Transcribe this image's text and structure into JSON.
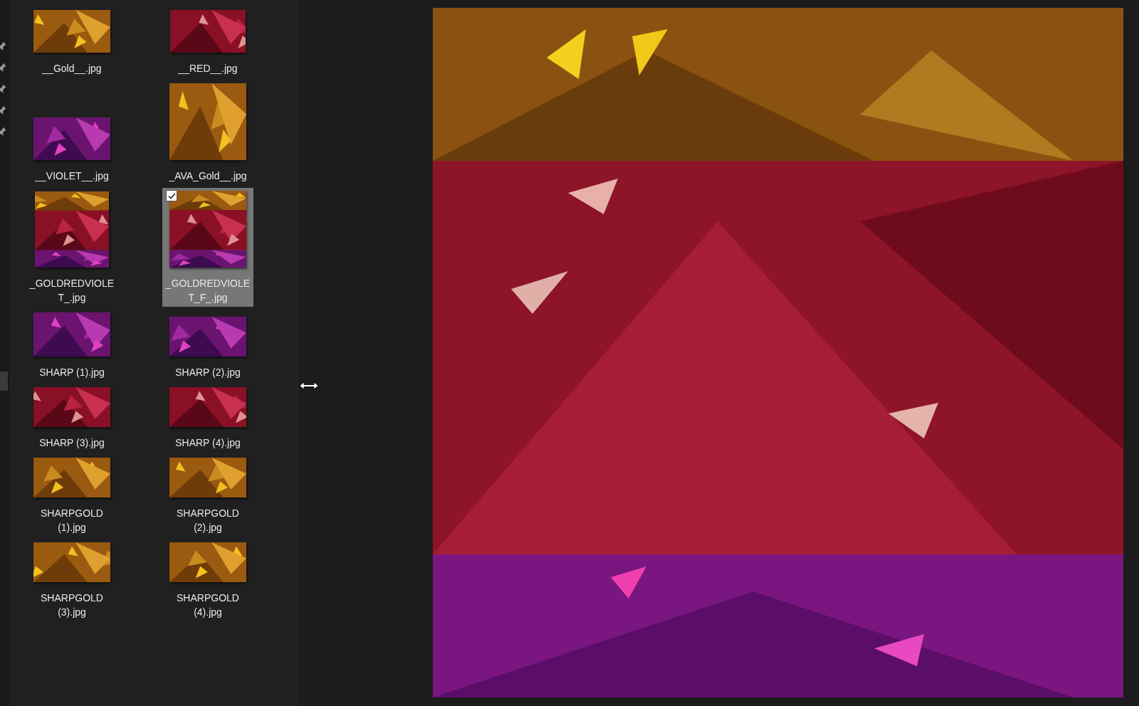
{
  "quick_access": {
    "pins": [
      {
        "kind": "pin"
      },
      {
        "kind": "pin"
      },
      {
        "kind": "pin"
      },
      {
        "kind": "pin"
      },
      {
        "kind": "pin"
      }
    ]
  },
  "files": [
    {
      "name": "__Gold__.jpg",
      "selected": false,
      "checked": false
    },
    {
      "name": "__RED__.jpg",
      "selected": false,
      "checked": false
    },
    {
      "name": "__VIOLET__.jpg",
      "selected": false,
      "checked": false
    },
    {
      "name": "_AVA_Gold__.jpg",
      "selected": false,
      "checked": false
    },
    {
      "name": "_GOLDREDVIOLET_.jpg",
      "selected": false,
      "checked": false
    },
    {
      "name": "_GOLDREDVIOLET_F_.jpg",
      "selected": true,
      "checked": true
    },
    {
      "name": "SHARP (1).jpg",
      "selected": false,
      "checked": false
    },
    {
      "name": "SHARP (2).jpg",
      "selected": false,
      "checked": false
    },
    {
      "name": "SHARP (3).jpg",
      "selected": false,
      "checked": false
    },
    {
      "name": "SHARP (4).jpg",
      "selected": false,
      "checked": false
    },
    {
      "name": "SHARPGOLD (1).jpg",
      "selected": false,
      "checked": false
    },
    {
      "name": "SHARPGOLD (2).jpg",
      "selected": false,
      "checked": false
    },
    {
      "name": "SHARPGOLD (3).jpg",
      "selected": false,
      "checked": false
    },
    {
      "name": "SHARPGOLD (4).jpg",
      "selected": false,
      "checked": false
    }
  ]
}
